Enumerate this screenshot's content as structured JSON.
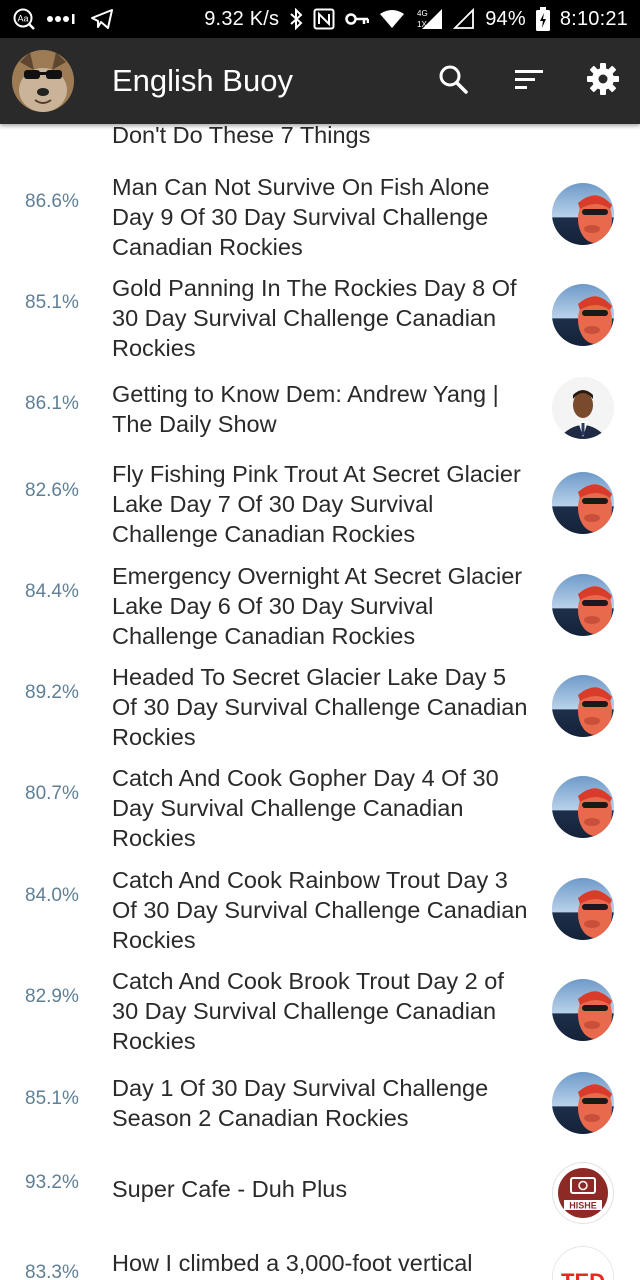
{
  "status_bar": {
    "net_speed": "9.32 K/s",
    "net_type": "4G",
    "net_sub": "1X",
    "battery": "94%",
    "time": "8:10:21"
  },
  "app_bar": {
    "title": "English Buoy",
    "icons": [
      "search-icon",
      "sort-icon",
      "settings-icon"
    ]
  },
  "videos": [
    {
      "score": "",
      "title": "Don't Do These 7 Things",
      "channel_icon": "woman-avatar"
    },
    {
      "score": "86.6%",
      "title": "Man Can Not Survive On Fish Alone Day 9 Of 30 Day Survival Challenge Canadian Rockies",
      "channel_icon": "survival-channel-avatar"
    },
    {
      "score": "85.1%",
      "title": "Gold Panning In The Rockies Day 8 Of 30 Day Survival Challenge Canadian Rockies",
      "channel_icon": "survival-channel-avatar"
    },
    {
      "score": "86.1%",
      "title": "Getting to Know Dem: Andrew Yang | The Daily Show",
      "channel_icon": "daily-show-avatar"
    },
    {
      "score": "82.6%",
      "title": "Fly Fishing Pink Trout At Secret Glacier Lake Day 7 Of 30 Day Survival Challenge Canadian Rockies",
      "channel_icon": "survival-channel-avatar"
    },
    {
      "score": "84.4%",
      "title": "Emergency Overnight At Secret Glacier Lake Day 6 Of 30 Day Survival Challenge Canadian Rockies",
      "channel_icon": "survival-channel-avatar"
    },
    {
      "score": "89.2%",
      "title": "Headed To Secret Glacier Lake Day 5 Of 30 Day Survival Challenge Canadian Rockies",
      "channel_icon": "survival-channel-avatar"
    },
    {
      "score": "80.7%",
      "title": "Catch And Cook Gopher Day 4 Of 30 Day Survival Challenge Canadian Rockies",
      "channel_icon": "survival-channel-avatar"
    },
    {
      "score": "84.0%",
      "title": "Catch And Cook Rainbow Trout Day 3 Of 30 Day Survival Challenge Canadian Rockies",
      "channel_icon": "survival-channel-avatar"
    },
    {
      "score": "82.9%",
      "title": "Catch And Cook Brook Trout Day 2 of 30 Day Survival Challenge Canadian Rockies",
      "channel_icon": "survival-channel-avatar"
    },
    {
      "score": "85.1%",
      "title": "Day 1 Of 30 Day Survival Challenge Season 2 Canadian Rockies",
      "channel_icon": "survival-channel-avatar"
    },
    {
      "score": "93.2%",
      "title": "Super Cafe - Duh Plus",
      "channel_icon": "hishe-avatar",
      "channel_badge": "HISHE"
    },
    {
      "score": "83.3%",
      "title": "How I climbed a 3,000-foot vertical",
      "channel_icon": "ted-avatar",
      "channel_badge": "TED"
    }
  ],
  "colors": {
    "status_bar_bg": "#000000",
    "app_bar_bg": "#2a2a2a",
    "score_text": "#5f7f95",
    "title_text": "#2a2a2a"
  }
}
